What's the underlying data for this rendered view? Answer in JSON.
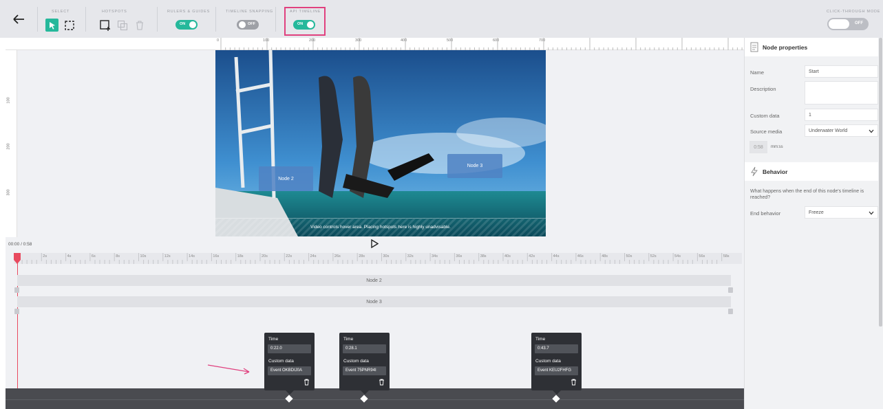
{
  "toolbar": {
    "select_label": "SELECT",
    "hotspots_label": "HOTSPOTS",
    "rulers_label": "RULERS & GUIDES",
    "rulers_state": "ON",
    "snapping_label": "TIMELINE SNAPPING",
    "snapping_state": "OFF",
    "api_label": "API TIMELINE",
    "api_state": "ON",
    "clickthrough_label": "CLICK-THROUGH MODE",
    "clickthrough_state": "OFF",
    "icons": [
      "back-arrow-icon",
      "pointer-icon",
      "marquee-icon",
      "add-hotspot-icon",
      "duplicate-icon",
      "trash-icon"
    ],
    "highlight_color": "#e0407e",
    "accent_color": "#25b89b"
  },
  "ruler": {
    "h_ticks": [
      "0",
      "100",
      "200",
      "300",
      "400",
      "500",
      "600",
      "700"
    ],
    "v_ticks": [
      "100",
      "200",
      "300"
    ]
  },
  "video": {
    "hotspots": [
      {
        "label": "Node 2"
      },
      {
        "label": "Node 3"
      }
    ],
    "hover_warning": "Video controls hover area. Placing hotspots here is highly unadvisable."
  },
  "player": {
    "time": "00:00 / 0:58"
  },
  "timeline": {
    "ticks": [
      "2s",
      "4s",
      "6s",
      "8s",
      "10s",
      "12s",
      "14s",
      "16s",
      "18s",
      "20s",
      "22s",
      "24s",
      "26s",
      "28s",
      "30s",
      "32s",
      "34s",
      "36s",
      "38s",
      "40s",
      "42s",
      "44s",
      "46s",
      "48s",
      "50s",
      "52s",
      "54s",
      "56s",
      "58s"
    ],
    "tracks": [
      {
        "label": "Node 2"
      },
      {
        "label": "Node 3"
      }
    ],
    "playhead_color": "#e84a5f"
  },
  "events": [
    {
      "time_label": "Time",
      "time": "0:22.0",
      "data_label": "Custom data",
      "data": "Event OKBDIJ0A"
    },
    {
      "time_label": "Time",
      "time": "0:28.1",
      "data_label": "Custom data",
      "data": "Event 75PNR94I"
    },
    {
      "time_label": "Time",
      "time": "0:43.7",
      "data_label": "Custom data",
      "data": "Event KEU2FHFG"
    }
  ],
  "properties": {
    "title": "Node properties",
    "name_label": "Name",
    "name_value": "Start",
    "description_label": "Description",
    "description_value": "",
    "custom_label": "Custom data",
    "custom_value": "1",
    "source_label": "Source media",
    "source_value": "Underwater World",
    "duration": "0:58",
    "duration_unit": "mm:ss",
    "behavior_title": "Behavior",
    "behavior_question": "What happens when the end of this node's timeline is reached?",
    "end_label": "End behavior",
    "end_value": "Freeze"
  }
}
